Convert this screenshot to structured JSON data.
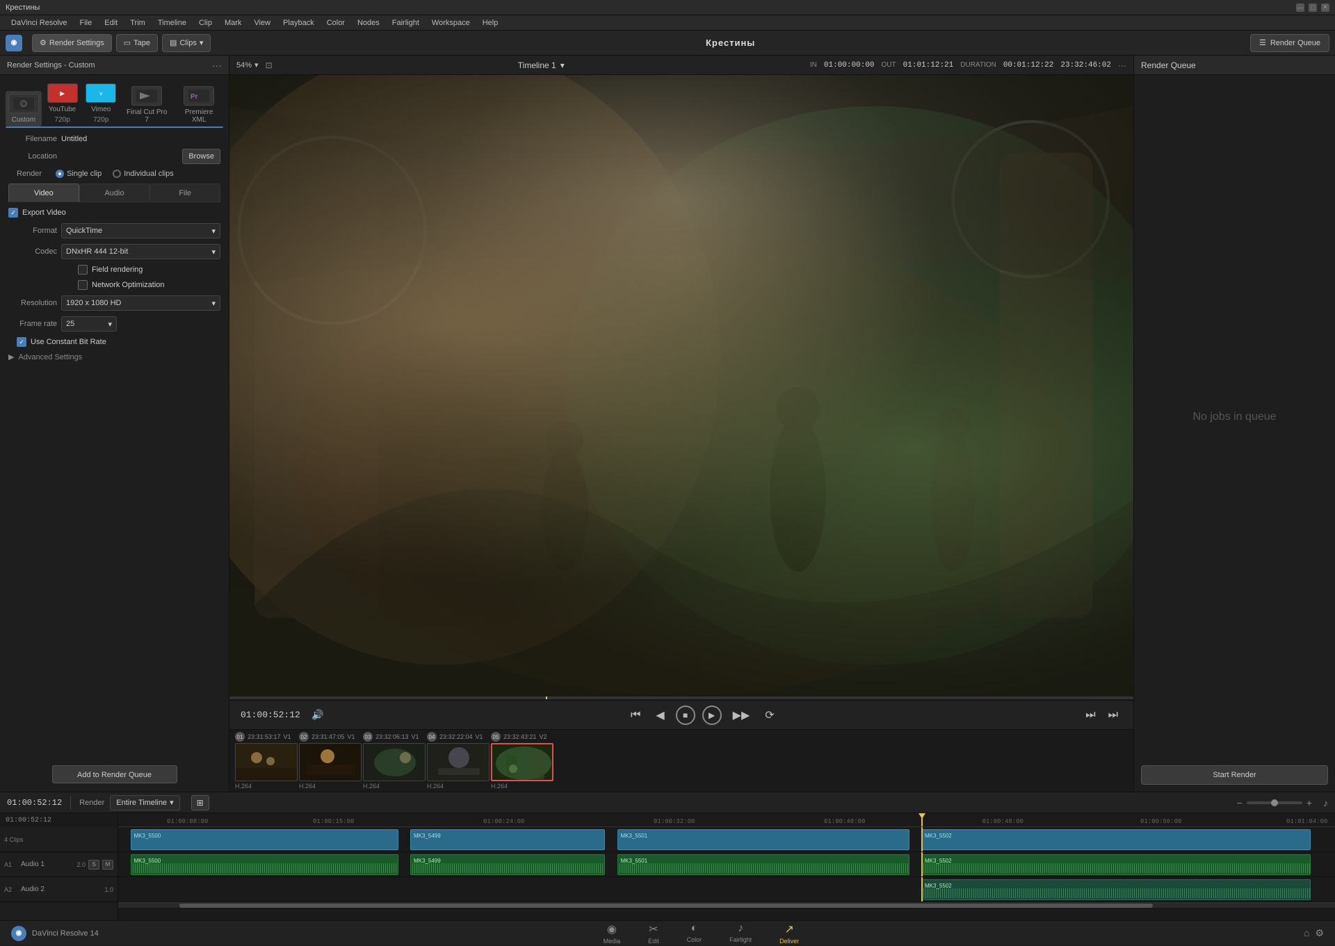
{
  "app": {
    "title": "Крестины",
    "window_title": "Крестины",
    "version": "DaVinci Resolve 14"
  },
  "titlebar": {
    "title": "Крестины",
    "min_label": "—",
    "max_label": "□",
    "close_label": "✕"
  },
  "menubar": {
    "items": [
      "DaVinci Resolve",
      "File",
      "Edit",
      "Trim",
      "Timeline",
      "Clip",
      "Mark",
      "View",
      "Playback",
      "Color",
      "Nodes",
      "Fairlight",
      "Workspace",
      "Help"
    ]
  },
  "toolbar": {
    "brand_label": "DR",
    "settings_label": "Render Settings",
    "tape_label": "Tape",
    "clips_label": "Clips",
    "project_name": "Крестины",
    "render_queue_label": "Render Queue"
  },
  "render_settings": {
    "panel_title": "Render Settings - Custom",
    "presets": [
      {
        "id": "custom",
        "icon": "▶",
        "label": "Custom",
        "sublabel": ""
      },
      {
        "id": "youtube",
        "icon": "▶",
        "label": "YouTube",
        "sublabel": "720p"
      },
      {
        "id": "vimeo",
        "icon": "v",
        "label": "Vimeo",
        "sublabel": "720p"
      },
      {
        "id": "finalcut",
        "icon": "🎬",
        "label": "Final Cut Pro 7",
        "sublabel": ""
      },
      {
        "id": "premiere",
        "icon": "Pr",
        "label": "Premiere XML",
        "sublabel": ""
      }
    ],
    "filename_label": "Filename",
    "filename_value": "Untitled",
    "location_label": "Location",
    "browse_label": "Browse",
    "render_label": "Render",
    "single_clip_label": "Single clip",
    "individual_clips_label": "Individual clips",
    "tabs": [
      "Video",
      "Audio",
      "File"
    ],
    "active_tab": "Video",
    "export_video_label": "Export Video",
    "format_label": "Format",
    "format_value": "QuickTime",
    "codec_label": "Codec",
    "codec_value": "DNxHR 444 12-bit",
    "field_rendering_label": "Field rendering",
    "network_opt_label": "Network Optimization",
    "resolution_label": "Resolution",
    "resolution_value": "1920 x 1080 HD",
    "framerate_label": "Frame rate",
    "framerate_value": "25",
    "constant_bitrate_label": "Use Constant Bit Rate",
    "advanced_label": "Advanced Settings",
    "add_to_queue_label": "Add to Render Queue"
  },
  "preview": {
    "zoom_value": "54%",
    "timeline_label": "Timeline 1",
    "in_label": "IN",
    "in_time": "01:00:00:00",
    "out_label": "OUT",
    "out_time": "01:01:12:21",
    "duration_label": "DURATION",
    "duration_value": "00:01:12:22",
    "timecode": "23:32:46:02",
    "playback_time": "01:00:52:12"
  },
  "clips": [
    {
      "num": "01",
      "timecode": "23:31:53:17",
      "track": "V1",
      "codec": "H.264",
      "color": "#3a3a2a"
    },
    {
      "num": "02",
      "timecode": "23:31:47:05",
      "track": "V1",
      "codec": "H.264",
      "color": "#2a2a1a"
    },
    {
      "num": "03",
      "timecode": "23:32:06:13",
      "track": "V1",
      "codec": "H.264",
      "color": "#2a3a2a"
    },
    {
      "num": "04",
      "timecode": "23:32:22:04",
      "track": "V1",
      "codec": "H.264",
      "color": "#2a2a2a"
    },
    {
      "num": "05",
      "timecode": "23:32:43:21",
      "track": "V2",
      "codec": "H.264",
      "color": "#3a5a3a",
      "selected": true
    }
  ],
  "render_queue": {
    "title": "Render Queue",
    "no_jobs_label": "No jobs in queue",
    "start_render_label": "Start Render"
  },
  "timeline": {
    "timecode": "01:00:52:12",
    "render_label": "Render",
    "render_mode": "Entire Timeline",
    "ruler_marks": [
      "01:00:08:00",
      "01:00:15:00",
      "01:00:24:00",
      "01:00:32:00",
      "01:00:40:00",
      "01:00:48:00",
      "01:00:56:00",
      "01:01:04:00"
    ],
    "clips_count": "4 Clips",
    "tracks": [
      {
        "name": "Audio 1",
        "volume": "2.0",
        "clips": [
          "MK3_5500",
          "MK3_5499",
          "MK3_5501",
          "MK3_5502"
        ]
      },
      {
        "name": "Audio 2",
        "volume": "1.0",
        "clips": [
          "MK3_5502"
        ]
      }
    ],
    "video_clips": [
      "MK3_5500",
      "MK3_5499",
      "MK3_5501",
      "MK3_5502"
    ]
  },
  "bottom_nav": {
    "items": [
      "Media",
      "Edit",
      "Color",
      "Fairlight",
      "Deliver"
    ],
    "active": "Deliver",
    "icons": [
      "◉",
      "✂",
      "◐",
      "♪",
      "↗"
    ]
  },
  "bottom": {
    "resolve_label": "DaVinci Resolve 14"
  }
}
